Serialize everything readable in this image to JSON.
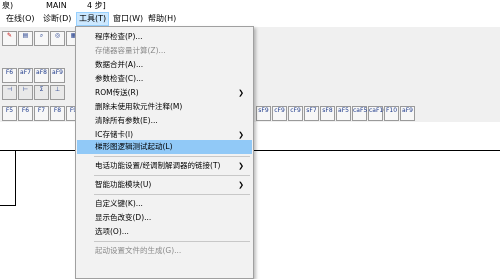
{
  "titlebar": {
    "left_fragment": "泉)",
    "project": "MAIN",
    "steps": "4 步]"
  },
  "menubar": [
    {
      "label": "在线(O)"
    },
    {
      "label": "诊断(D)"
    },
    {
      "label": "工具(T)"
    },
    {
      "label": "窗口(W)"
    },
    {
      "label": "帮助(H)"
    }
  ],
  "toolbar": {
    "row2": [
      "F6",
      "aF7",
      "aF8",
      "aF9"
    ],
    "row3": [
      "F5",
      "F6",
      "F7",
      "F8",
      "F9"
    ],
    "row3b": [
      "sF9",
      "cF9",
      "cF9",
      "sF7",
      "sF8",
      "aF5",
      "caF5",
      "caF10",
      "F10",
      "aF9"
    ]
  },
  "tools_menu": {
    "items": [
      {
        "label": "程序检查(P)...",
        "disabled": false,
        "submenu": false,
        "highlight": false
      },
      {
        "label": "存储器容量计算(Z)...",
        "disabled": true,
        "submenu": false,
        "highlight": false
      },
      {
        "label": "数据合并(A)...",
        "disabled": false,
        "submenu": false,
        "highlight": false
      },
      {
        "label": "参数检查(C)...",
        "disabled": false,
        "submenu": false,
        "highlight": false
      },
      {
        "label": "ROM传送(R)",
        "disabled": false,
        "submenu": true,
        "highlight": false
      },
      {
        "label": "删除未使用软元件注释(M)",
        "disabled": false,
        "submenu": false,
        "highlight": false
      },
      {
        "label": "清除所有参数(E)...",
        "disabled": false,
        "submenu": false,
        "highlight": false
      },
      {
        "label": "IC存储卡(I)",
        "disabled": false,
        "submenu": true,
        "highlight": false
      },
      {
        "label": "梯形图逻辑测试起动(L)",
        "disabled": false,
        "submenu": false,
        "highlight": true
      },
      {
        "label": "电话功能设置/经调制解调器的链接(T)",
        "disabled": false,
        "submenu": true,
        "highlight": false
      },
      {
        "label": "智能功能模块(U)",
        "disabled": false,
        "submenu": true,
        "highlight": false
      },
      {
        "label": "自定义键(K)...",
        "disabled": false,
        "submenu": false,
        "highlight": false
      },
      {
        "label": "显示色改变(D)...",
        "disabled": false,
        "submenu": false,
        "highlight": false
      },
      {
        "label": "选项(O)...",
        "disabled": false,
        "submenu": false,
        "highlight": false
      },
      {
        "label": "起动设置文件的生成(G)...",
        "disabled": true,
        "submenu": false,
        "highlight": false
      }
    ]
  }
}
